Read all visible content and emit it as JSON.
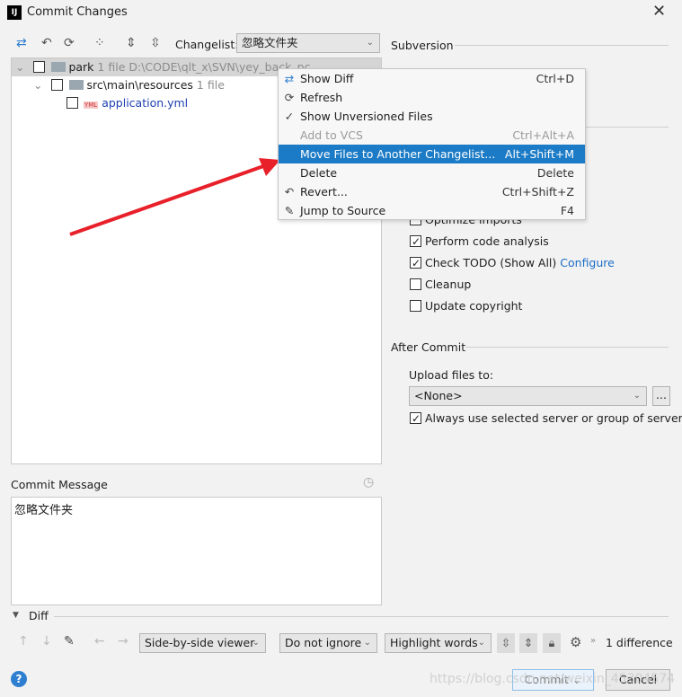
{
  "window": {
    "title": "Commit Changes",
    "logo": "IJ"
  },
  "toolbar": {
    "changelist_label": "Changelist:",
    "changelist_value": "忽略文件夹"
  },
  "tree": [
    {
      "name": "park",
      "count": "1 file",
      "path": "D:\\CODE\\qlt_x\\SVN\\yey_back_pc"
    },
    {
      "name": "src\\main\\resources",
      "count": "1 file"
    },
    {
      "name": "application.yml",
      "badge": "YML"
    }
  ],
  "context_menu": [
    {
      "label": "Show Diff",
      "shortcut": "Ctrl+D",
      "icon": "diff-icon"
    },
    {
      "label": "Refresh",
      "shortcut": "",
      "icon": "refresh-icon"
    },
    {
      "label": "Show Unversioned Files",
      "shortcut": "",
      "icon": "check-icon"
    },
    {
      "label": "Add to VCS",
      "shortcut": "Ctrl+Alt+A",
      "disabled": true
    },
    {
      "label": "Move Files to Another Changelist...",
      "shortcut": "Alt+Shift+M",
      "highlighted": true
    },
    {
      "label": "Delete",
      "shortcut": "Delete"
    },
    {
      "label": "Revert...",
      "shortcut": "Ctrl+Shift+Z",
      "icon": "revert-icon"
    },
    {
      "label": "Jump to Source",
      "shortcut": "F4",
      "icon": "edit-icon"
    }
  ],
  "right": {
    "subversion": "Subversion",
    "options": [
      {
        "label": "Optimize imports",
        "checked": false
      },
      {
        "label": "Perform code analysis",
        "checked": true
      },
      {
        "label": "Check TODO (Show All)",
        "checked": true,
        "link": "Configure"
      },
      {
        "label": "Cleanup",
        "checked": false
      },
      {
        "label": "Update copyright",
        "checked": false
      }
    ],
    "after_commit": "After Commit",
    "upload_label": "Upload files to:",
    "upload_value": "<None>",
    "browse": "...",
    "always_use": "Always use selected server or group of servers",
    "always_checked": true
  },
  "commit_message": {
    "label": "Commit Message",
    "value": "忽略文件夹"
  },
  "diff": {
    "label": "Diff",
    "viewer": "Side-by-side viewer",
    "ignore": "Do not ignore",
    "highlight": "Highlight words",
    "count": "1 difference"
  },
  "buttons": {
    "commit": "Commit",
    "cancel": "Cancel",
    "help": "?"
  },
  "watermark": "https://blog.csdn.net/weixin_45304574",
  "colors": {
    "highlight": "#1c7bc6",
    "link": "#1c6dc6",
    "arrow": "#e8202a"
  }
}
